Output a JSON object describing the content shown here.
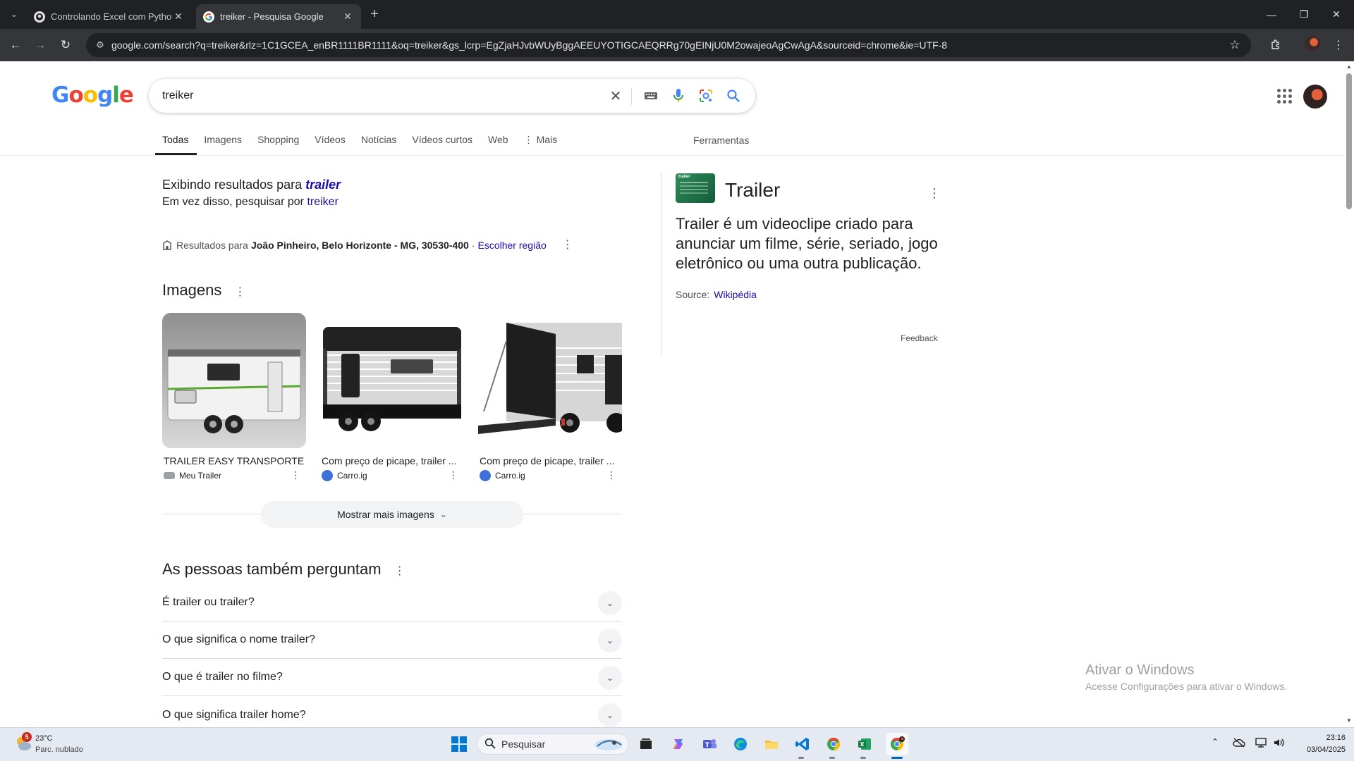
{
  "browser": {
    "tabs": [
      {
        "title": "Controlando Excel com Python",
        "active": false
      },
      {
        "title": "treiker - Pesquisa Google",
        "active": true
      }
    ],
    "url": "google.com/search?q=treiker&rlz=1C1GCEA_enBR1111BR1111&oq=treiker&gs_lcrp=EgZjaHJvbWUyBggAEEUYOTIGCAEQRRg70gEINjU0M2owajeoAgCwAgA&sourceid=chrome&ie=UTF-8"
  },
  "search": {
    "logo": "Google",
    "query": "treiker"
  },
  "nav_tabs": {
    "todas": "Todas",
    "imagens": "Imagens",
    "shopping": "Shopping",
    "videos": "Vídeos",
    "noticias": "Notícias",
    "videos_curtos": "Vídeos curtos",
    "web": "Web",
    "mais": "Mais",
    "ferramentas": "Ferramentas"
  },
  "spelling": {
    "showing_prefix": "Exibindo resultados para",
    "corrected_term": "trailer",
    "instead_prefix": "Em vez disso, pesquisar por",
    "original_term": "treiker"
  },
  "location": {
    "prefix": "Resultados para",
    "place": "João Pinheiro, Belo Horizonte - MG, 30530-400",
    "separator": "·",
    "change_link": "Escolher região"
  },
  "images_section": {
    "title": "Imagens",
    "cards": [
      {
        "caption": "TRAILER EASY TRANSPORTE",
        "source": "Meu Trailer"
      },
      {
        "caption": "Com preço de picape, trailer ...",
        "source": "Carro.ig"
      },
      {
        "caption": "Com preço de picape, trailer ...",
        "source": "Carro.ig"
      }
    ],
    "more_button": "Mostrar mais imagens"
  },
  "paa": {
    "title": "As pessoas também perguntam",
    "questions": [
      "É trailer ou trailer?",
      "O que significa o nome trailer?",
      "O que é trailer no filme?",
      "O que significa trailer home?"
    ]
  },
  "knowledge_panel": {
    "thumb_text": "trailer",
    "title": "Trailer",
    "description": "Trailer é um videoclipe criado para anunciar um filme, série, seriado, jogo eletrônico ou uma outra publicação.",
    "source_label": "Source:",
    "source_link": "Wikipédia",
    "feedback": "Feedback"
  },
  "watermark": {
    "line1": "Ativar o Windows",
    "line2": "Acesse Configurações para ativar o Windows."
  },
  "taskbar": {
    "weather_badge": "5",
    "weather_temp": "23°C",
    "weather_desc": "Parc. nublado",
    "search_placeholder": "Pesquisar",
    "time": "23:16",
    "date": "03/04/2025"
  },
  "colors": {
    "chrome_frame": "#202124",
    "chrome_toolbar": "#35363a",
    "link_blue": "#1a0dab",
    "google_blue": "#4285F4",
    "google_red": "#EA4335",
    "google_yellow": "#FBBC05",
    "google_green": "#34A853"
  }
}
